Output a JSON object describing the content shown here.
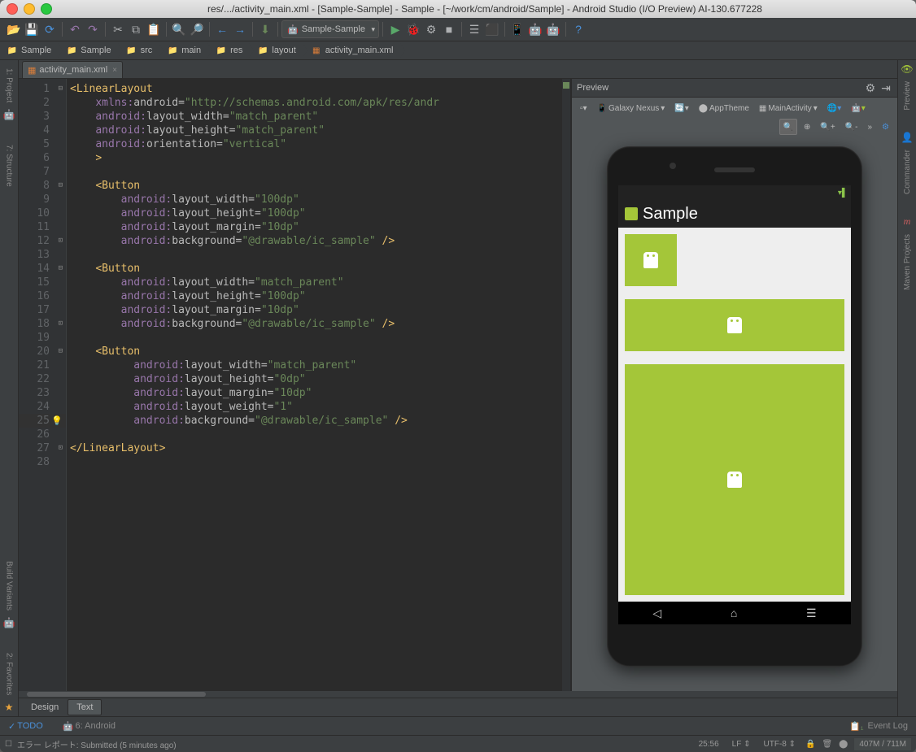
{
  "title": "res/.../activity_main.xml - [Sample-Sample] - Sample - [~/work/cm/android/Sample] - Android Studio (I/O Preview) AI-130.677228",
  "toolbar": {
    "run_config": "Sample-Sample"
  },
  "breadcrumbs": [
    "Sample",
    "Sample",
    "src",
    "main",
    "res",
    "layout",
    "activity_main.xml"
  ],
  "left_rail": [
    "1: Project",
    "7: Structure",
    "Build Variants",
    "2: Favorites"
  ],
  "right_rail": [
    "Preview",
    "Commander",
    "Maven Projects"
  ],
  "editor": {
    "tab": "activity_main.xml",
    "lines": [
      1,
      2,
      3,
      4,
      5,
      6,
      7,
      8,
      9,
      10,
      11,
      12,
      13,
      14,
      15,
      16,
      17,
      18,
      19,
      20,
      21,
      22,
      23,
      24,
      25,
      26,
      27,
      28
    ],
    "code_html": "<span class='tag'>&lt;LinearLayout</span>\n    <span class='ns'>xmlns:</span><span class='attr'>android=</span><span class='str'>\"http://schemas.android.com/apk/res/andr</span>\n    <span class='ns'>android:</span><span class='attr'>layout_width=</span><span class='str'>\"match_parent\"</span>\n    <span class='ns'>android:</span><span class='attr'>layout_height=</span><span class='str'>\"match_parent\"</span>\n    <span class='ns'>android:</span><span class='attr'>orientation=</span><span class='str'>\"vertical\"</span>\n    <span class='tag'>&gt;</span>\n\n    <span class='tag'>&lt;Button</span>\n        <span class='ns'>android:</span><span class='attr'>layout_width=</span><span class='str'>\"100dp\"</span>\n        <span class='ns'>android:</span><span class='attr'>layout_height=</span><span class='str'>\"100dp\"</span>\n        <span class='ns'>android:</span><span class='attr'>layout_margin=</span><span class='str'>\"10dp\"</span>\n        <span class='ns'>android:</span><span class='attr'>background=</span><span class='str'>\"@drawable/ic_sample\"</span> <span class='tag'>/&gt;</span>\n\n    <span class='tag'>&lt;Button</span>\n        <span class='ns'>android:</span><span class='attr'>layout_width=</span><span class='str'>\"match_parent\"</span>\n        <span class='ns'>android:</span><span class='attr'>layout_height=</span><span class='str'>\"100dp\"</span>\n        <span class='ns'>android:</span><span class='attr'>layout_margin=</span><span class='str'>\"10dp\"</span>\n        <span class='ns'>android:</span><span class='attr'>background=</span><span class='str'>\"@drawable/ic_sample\"</span> <span class='tag'>/&gt;</span>\n\n    <span class='tag'>&lt;Button</span>\n          <span class='ns'>android:</span><span class='attr'>layout_width=</span><span class='str'>\"match_parent\"</span>\n          <span class='ns'>android:</span><span class='attr'>layout_height=</span><span class='str'>\"0dp\"</span>\n          <span class='ns'>android:</span><span class='attr'>layout_margin=</span><span class='str'>\"10dp\"</span>\n          <span class='ns'>android:</span><span class='attr'>layout_weight=</span><span class='str'>\"1\"</span>\n          <span class='ns'>android:</span><span class='attr'>background=</span><span class='str'>\"@drawable/ic_sample\"</span> <span class='tag'>/&gt;</span>\n\n<span class='tag'>&lt;/LinearLayout&gt;</span>\n"
  },
  "design_tabs": {
    "design": "Design",
    "text": "Text"
  },
  "preview": {
    "title": "Preview",
    "device": "Galaxy Nexus",
    "theme": "AppTheme",
    "activity": "MainActivity",
    "app_title": "Sample"
  },
  "status": {
    "todo": "TODO",
    "android": "6: Android",
    "event_log": "Event Log",
    "error_report": "エラー レポート: Submitted (5 minutes ago)",
    "caret": "25:56",
    "line_sep": "LF",
    "encoding": "UTF-8",
    "memory": "407M / 711M"
  }
}
